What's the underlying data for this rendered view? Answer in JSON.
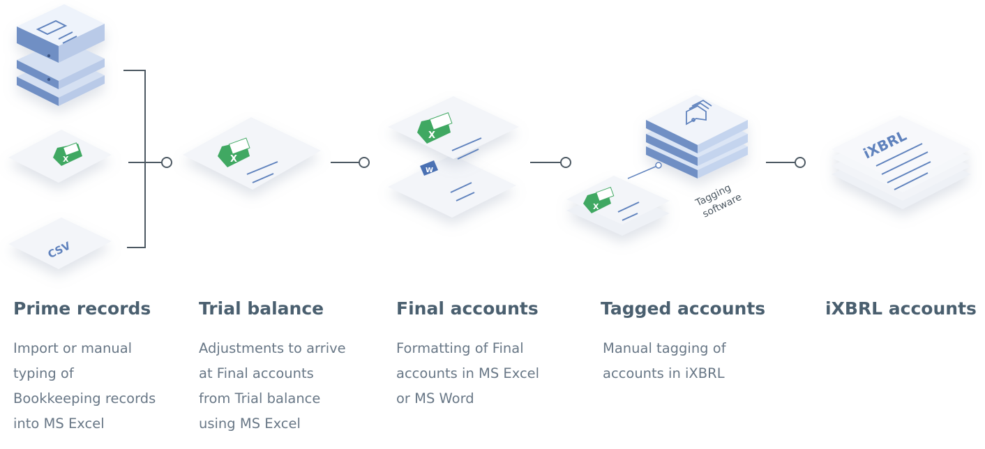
{
  "stages": [
    {
      "title": "Prime records",
      "lines": [
        "Import or manual",
        "typing of",
        "Bookkeeping records",
        "into MS Excel"
      ]
    },
    {
      "title": "Trial balance",
      "lines": [
        "Adjustments to arrive",
        "at Final accounts",
        "from Trial balance",
        "using MS Excel"
      ]
    },
    {
      "title": "Final accounts",
      "lines": [
        "Formatting of Final",
        "accounts in MS Excel",
        "or MS Word"
      ]
    },
    {
      "title": "Tagged accounts",
      "lines": [
        "Manual tagging of",
        "accounts in iXBRL"
      ]
    },
    {
      "title": "iXBRL accounts",
      "lines": []
    }
  ],
  "diagram": {
    "csv_label": "CSV",
    "excel_glyph": "X",
    "word_glyph": "W",
    "tagging_label_line1": "Tagging",
    "tagging_label_line2": "software",
    "ixbrl_label": "iXBRL"
  },
  "colors": {
    "server_blue": "#6f8fc4",
    "server_light": "#c4d4ee",
    "excel_green": "#3fa862",
    "connector": "#4c5862",
    "title": "#4a5f6f",
    "text": "#687786",
    "doc_line": "#5f82bd"
  }
}
